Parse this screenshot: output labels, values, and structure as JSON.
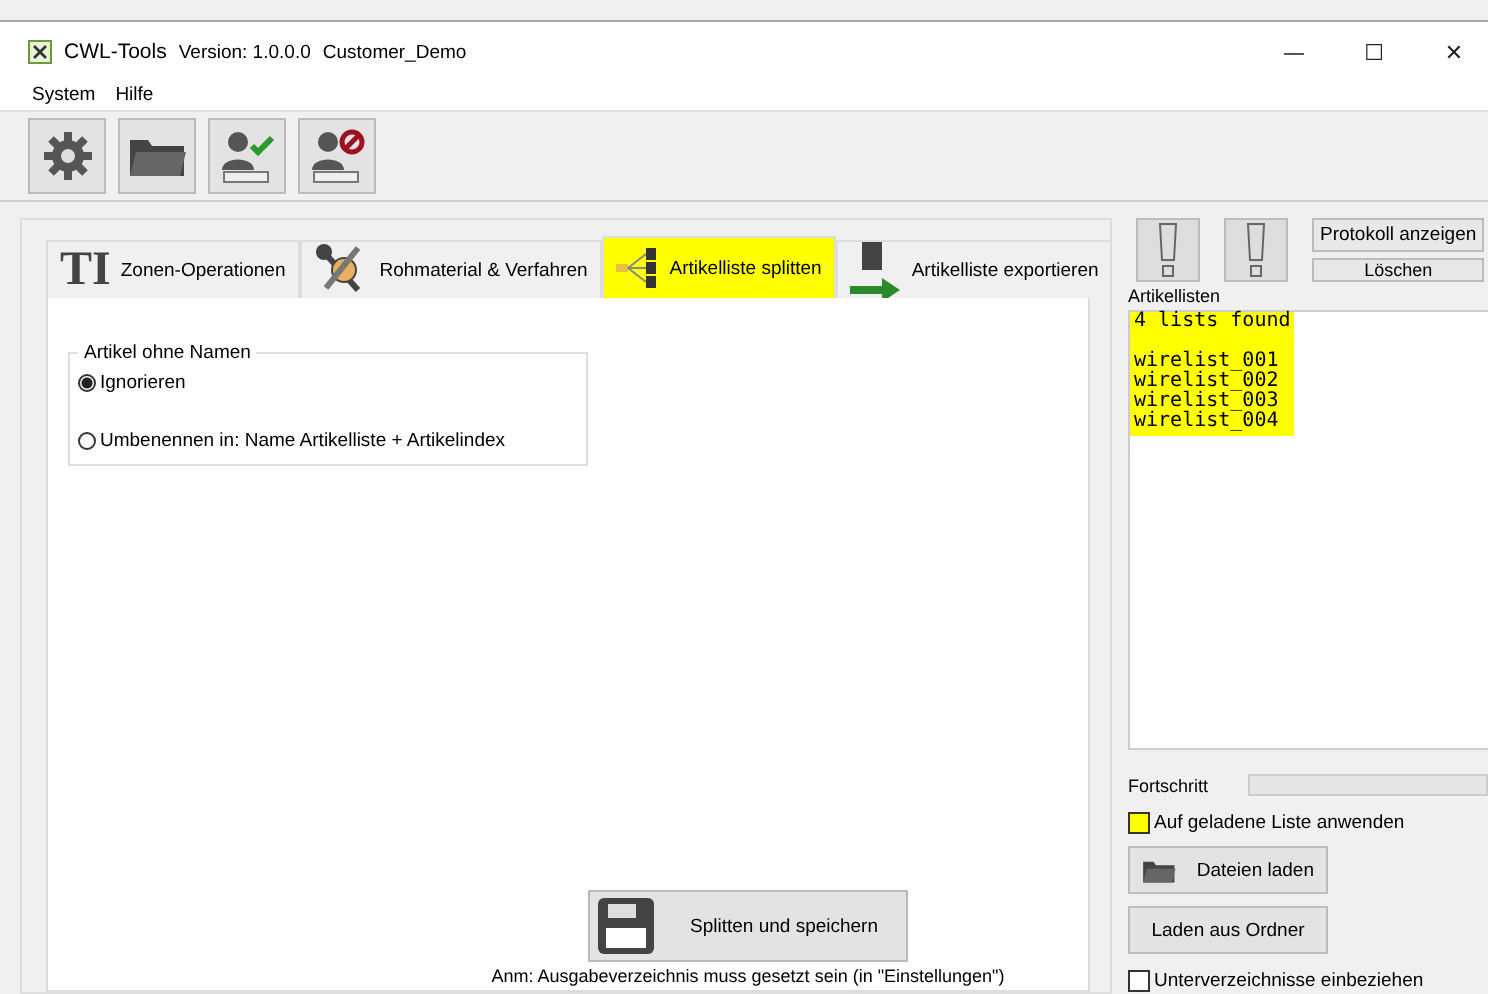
{
  "window": {
    "title": "CWL-Tools",
    "version": "Version: 1.0.0.0",
    "customer": "Customer_Demo",
    "controls": [
      "—",
      "☐",
      "✕"
    ]
  },
  "menu": [
    "System",
    "Hilfe"
  ],
  "toolbar": [
    {
      "kind": "settings"
    },
    {
      "kind": "folder"
    },
    {
      "kind": "login"
    },
    {
      "kind": "logout"
    }
  ],
  "tabs": [
    {
      "label": "Zonen-Operationen",
      "kind": "text",
      "icon_text": "TI",
      "selected": false
    },
    {
      "label": "Rohmaterial & Verfahren",
      "kind": "tools",
      "selected": false
    },
    {
      "label": "Artikelliste splitten",
      "kind": "split",
      "selected": true
    },
    {
      "label": "Artikelliste exportieren",
      "kind": "export",
      "selected": false
    }
  ],
  "group": {
    "title": "Artikel ohne Namen",
    "options": [
      {
        "label": "Ignorieren",
        "selected": true
      },
      {
        "label": "Umbenennen in: Name Artikelliste + Artikelindex",
        "selected": false
      }
    ]
  },
  "split_button": "Splitten und speichern",
  "note": "Anm: Ausgabeverzeichnis muss gesetzt sein (in \"Einstellungen\")",
  "right": {
    "protocol_button": "Protokoll anzeigen",
    "clear_button": "Löschen",
    "lists_label": "Artikellisten",
    "log_header": "4 lists found",
    "log_lines": [
      "wirelist_001",
      "wirelist_002",
      "wirelist_003",
      "wirelist_004"
    ],
    "progress_label": "Fortschritt",
    "progress": {
      "level": 0
    },
    "apply_checkbox": {
      "label": "Auf geladene Liste anwenden",
      "checked": false,
      "highlighted": true
    },
    "load_files_button": "Dateien laden",
    "load_folder_button": "Laden aus Ordner",
    "subdirs_checkbox": {
      "label": "Unterverzeichnisse einbeziehen",
      "checked": false,
      "highlighted": false
    }
  }
}
